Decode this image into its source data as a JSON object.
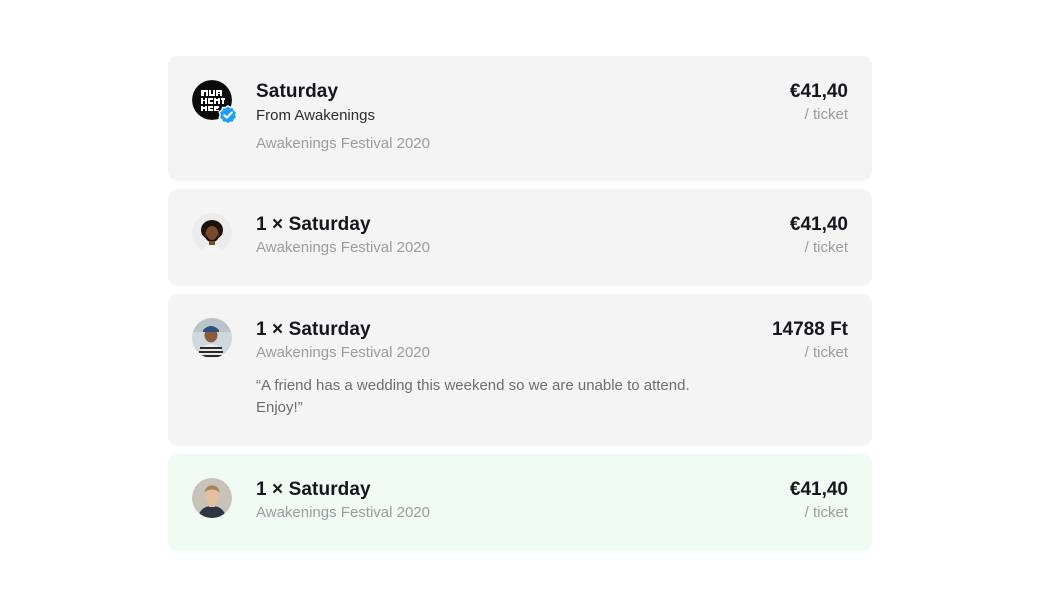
{
  "listings": [
    {
      "title": "Saturday",
      "seller": "From Awakenings",
      "event": "Awakenings Festival 2020",
      "price": "€41,40",
      "unit": "/ ticket",
      "avatar_icon": "awakenings-logo",
      "verified": true
    },
    {
      "title": "1 × Saturday",
      "event": "Awakenings Festival 2020",
      "price": "€41,40",
      "unit": "/ ticket",
      "avatar_icon": "user-avatar"
    },
    {
      "title": "1 × Saturday",
      "event": "Awakenings Festival 2020",
      "note": "“A friend has a wedding this weekend so we are unable to attend. Enjoy!”",
      "price": "14788 Ft",
      "unit": "/ ticket",
      "avatar_icon": "user-avatar"
    },
    {
      "title": "1 × Saturday",
      "event": "Awakenings Festival 2020",
      "price": "€41,40",
      "unit": "/ ticket",
      "avatar_icon": "user-avatar",
      "highlighted": true
    }
  ],
  "colors": {
    "card_bg": "#f4f4f4",
    "highlight_bg": "#effbf3",
    "verified_badge": "#1da1f2"
  }
}
